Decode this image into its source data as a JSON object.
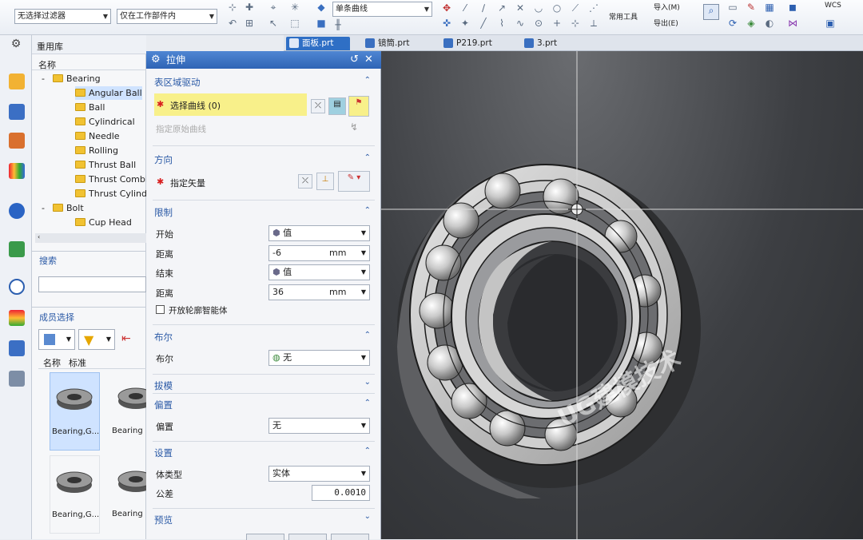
{
  "toolbar": {
    "filter_combo": "无选择过滤器",
    "scope_combo": "仅在工作部件内",
    "curve_rule_combo": "单条曲线",
    "common_tools": "常用工具",
    "import": "导入(M)",
    "export": "导出(E)",
    "wcs": "WCS"
  },
  "tabs": [
    "面板.prt",
    "镜筒.prt",
    "P219.prt",
    "3.prt"
  ],
  "nav": {
    "title": "重用库",
    "column": "名称",
    "tree": [
      {
        "label": "Bearing",
        "level": 0,
        "toggle": "-"
      },
      {
        "label": "Angular Ball",
        "level": 1
      },
      {
        "label": "Ball",
        "level": 1
      },
      {
        "label": "Cylindrical",
        "level": 1
      },
      {
        "label": "Needle",
        "level": 1
      },
      {
        "label": "Rolling",
        "level": 1
      },
      {
        "label": "Thrust Ball",
        "level": 1
      },
      {
        "label": "Thrust Combi",
        "level": 1
      },
      {
        "label": "Thrust Cylind",
        "level": 1
      },
      {
        "label": "Bolt",
        "level": 0,
        "toggle": "-"
      },
      {
        "label": "Cup Head",
        "level": 1
      }
    ],
    "search_label": "搜索",
    "member_label": "成员选择",
    "member_cols": [
      "名称",
      "标准"
    ],
    "thumbs": [
      "Bearing,G...",
      "Bearing",
      "Bearing,G...",
      "Bearing"
    ]
  },
  "dialog": {
    "title": "拉伸",
    "sec_region": "表区域驱动",
    "select_curve": "选择曲线 (0)",
    "specify_source": "指定原始曲线",
    "sec_direction": "方向",
    "specify_vector": "指定矢量",
    "sec_limits": "限制",
    "start_label": "开始",
    "start_value": "值",
    "dist1_label": "距离",
    "dist1_value": "-6",
    "dist1_unit": "mm",
    "end_label": "结束",
    "end_value": "值",
    "dist2_label": "距离",
    "dist2_value": "36",
    "dist2_unit": "mm",
    "open_profile": "开放轮廓智能体",
    "sec_bool": "布尔",
    "bool_label": "布尔",
    "bool_value": "无",
    "sec_draft": "拔模",
    "sec_offset": "偏置",
    "offset_label": "偏置",
    "offset_value": "无",
    "sec_settings": "设置",
    "body_type_label": "体类型",
    "body_type_value": "实体",
    "tolerance_label": "公差",
    "tolerance_value": "0.0010",
    "sec_preview": "预览"
  },
  "watermark": "UG建模技术",
  "colors": {
    "accent": "#2f6fc5",
    "highlight": "#f8f08a",
    "required": "#d81e1e"
  }
}
